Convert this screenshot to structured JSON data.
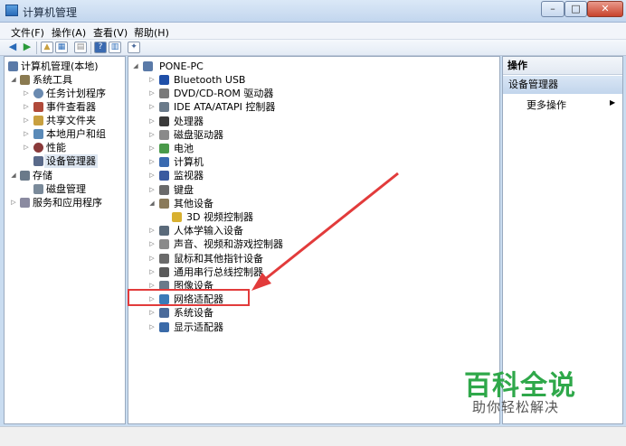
{
  "window": {
    "title": "计算机管理"
  },
  "menu": [
    "文件(F)",
    "操作(A)",
    "查看(V)",
    "帮助(H)"
  ],
  "left_tree": [
    {
      "label": "计算机管理(本地)",
      "icon": "computer-icon",
      "color": "#5a7aa8"
    },
    {
      "label": "系统工具",
      "icon": "tools-icon",
      "color": "#8a7a50"
    },
    {
      "label": "任务计划程序",
      "icon": "clock-icon",
      "color": "#6a8ab0"
    },
    {
      "label": "事件查看器",
      "icon": "event-viewer-icon",
      "color": "#b04a3a"
    },
    {
      "label": "共享文件夹",
      "icon": "shared-folder-icon",
      "color": "#c8a040"
    },
    {
      "label": "本地用户和组",
      "icon": "users-icon",
      "color": "#5a8ab8"
    },
    {
      "label": "性能",
      "icon": "performance-icon",
      "color": "#8a3a3a"
    },
    {
      "label": "设备管理器",
      "icon": "device-manager-icon",
      "color": "#5a6a8a"
    },
    {
      "label": "存储",
      "icon": "storage-icon",
      "color": "#6a7a8a"
    },
    {
      "label": "磁盘管理",
      "icon": "disk-icon",
      "color": "#7a8a9a"
    },
    {
      "label": "服务和应用程序",
      "icon": "services-icon",
      "color": "#8a8aa0"
    }
  ],
  "device_tree": {
    "root": "PONE-PC",
    "items": [
      {
        "label": "Bluetooth USB",
        "icon": "bluetooth-icon",
        "color": "#1f4fa8"
      },
      {
        "label": "DVD/CD-ROM 驱动器",
        "icon": "dvd-drive-icon",
        "color": "#7a7a7a"
      },
      {
        "label": "IDE ATA/ATAPI 控制器",
        "icon": "ide-controller-icon",
        "color": "#6a7a8a"
      },
      {
        "label": "处理器",
        "icon": "processor-icon",
        "color": "#3a3a3a"
      },
      {
        "label": "磁盘驱动器",
        "icon": "disk-drive-icon",
        "color": "#8a8a8a"
      },
      {
        "label": "电池",
        "icon": "battery-icon",
        "color": "#4a9a4a"
      },
      {
        "label": "计算机",
        "icon": "computer-icon",
        "color": "#3a6ab0"
      },
      {
        "label": "监视器",
        "icon": "monitor-icon",
        "color": "#3a5aa0"
      },
      {
        "label": "键盘",
        "icon": "keyboard-icon",
        "color": "#6a6a6a"
      },
      {
        "label": "其他设备",
        "icon": "other-devices-icon",
        "color": "#8a7a5a"
      },
      {
        "label": "3D 视频控制器",
        "icon": "warning-device-icon",
        "color": "#d8b030"
      },
      {
        "label": "人体学输入设备",
        "icon": "hid-icon",
        "color": "#5a6a7a"
      },
      {
        "label": "声音、视频和游戏控制器",
        "icon": "sound-icon",
        "color": "#8a8a8a"
      },
      {
        "label": "鼠标和其他指针设备",
        "icon": "mouse-icon",
        "color": "#6a6a6a"
      },
      {
        "label": "通用串行总线控制器",
        "icon": "usb-icon",
        "color": "#5a5a5a"
      },
      {
        "label": "图像设备",
        "icon": "imaging-icon",
        "color": "#6a7a8a"
      },
      {
        "label": "网络适配器",
        "icon": "network-adapter-icon",
        "color": "#3a7ab8"
      },
      {
        "label": "系统设备",
        "icon": "system-device-icon",
        "color": "#4a6a9a"
      },
      {
        "label": "显示适配器",
        "icon": "display-adapter-icon",
        "color": "#3a6aa8"
      }
    ]
  },
  "actions": {
    "header": "操作",
    "section": "设备管理器",
    "more": "更多操作"
  },
  "watermark": {
    "big": "百科全说",
    "small": "助你轻松解决",
    "color": "#2fa84a"
  }
}
